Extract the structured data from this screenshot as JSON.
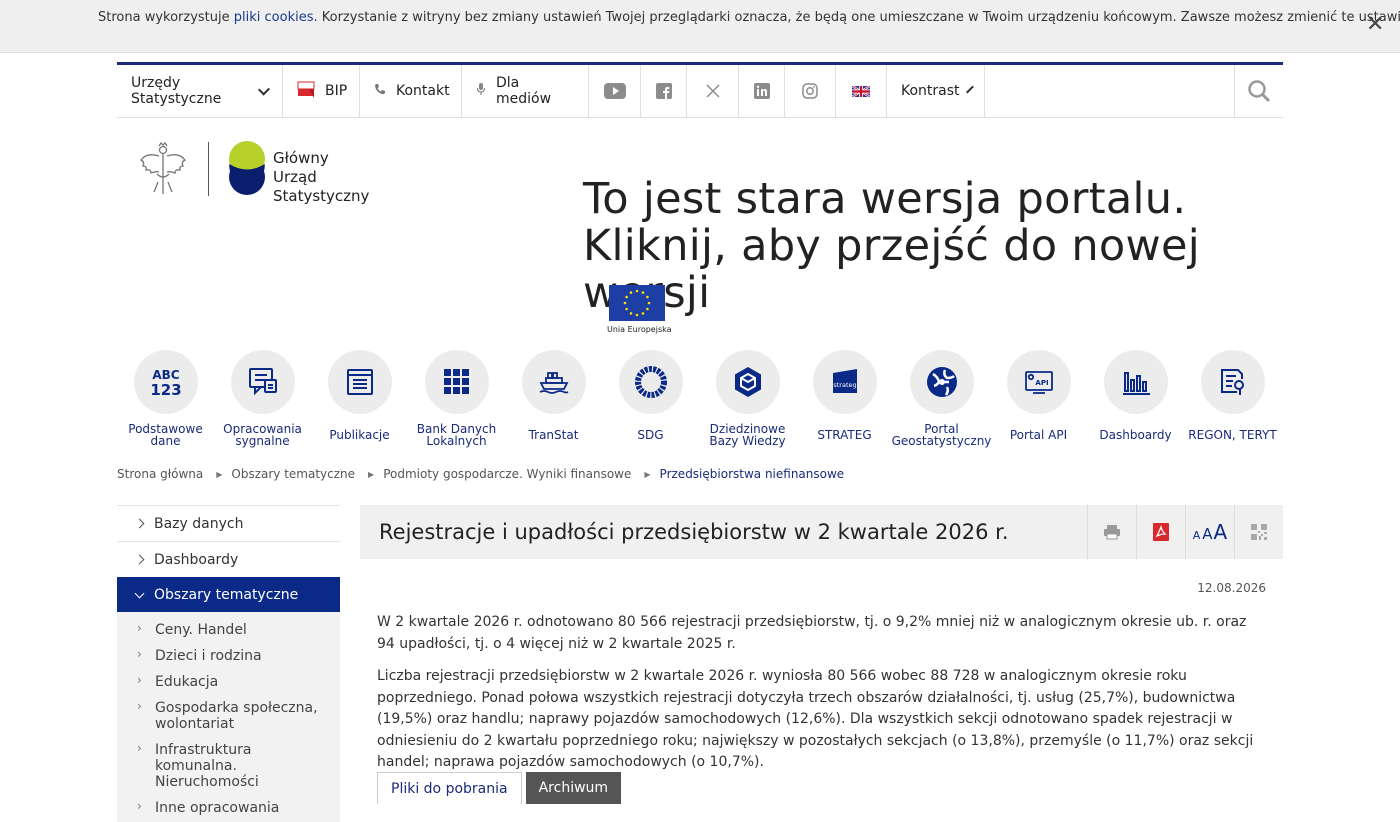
{
  "cookie": {
    "text_before": "Strona wykorzystuje ",
    "link": "pliki cookies",
    "text_after": ". Korzystanie z witryny bez zmiany ustawień Twojej przeglądarki oznacza, że będą one umieszczane w Twoim urządzeniu końcowym. Zawsze możesz zmienić te ustawienia.",
    "close": "✕"
  },
  "topnav": {
    "offices": "Urzędy Statystyczne",
    "bip": "BIP",
    "contact": "Kontakt",
    "media": "Dla mediów",
    "contrast": "Kontrast"
  },
  "logo": {
    "line1": "Główny",
    "line2": "Urząd Statystyczny"
  },
  "headline": "To jest stara wersja portalu. Kliknij, aby przejść do nowej wersji",
  "eu_label": "Unia Europejska",
  "icons": [
    {
      "label": "Podstawowe dane"
    },
    {
      "label": "Opracowania sygnalne"
    },
    {
      "label": "Publikacje"
    },
    {
      "label": "Bank Danych Lokalnych"
    },
    {
      "label": "TranStat"
    },
    {
      "label": "SDG"
    },
    {
      "label": "Dziedzinowe Bazy Wiedzy"
    },
    {
      "label": "STRATEG"
    },
    {
      "label": "Portal Geostatystyczny"
    },
    {
      "label": "Portal API"
    },
    {
      "label": "Dashboardy"
    },
    {
      "label": "REGON, TERYT"
    }
  ],
  "icon_text": {
    "abc": "ABC",
    "num": "123",
    "strateg": "strateg",
    "api": "API"
  },
  "breadcrumb": [
    "Strona główna",
    "Obszary tematyczne",
    "Podmioty gospodarcze. Wyniki finansowe",
    "Przedsiębiorstwa niefinansowe"
  ],
  "sidebar": {
    "top": [
      "Bazy danych",
      "Dashboardy"
    ],
    "active": "Obszary tematyczne",
    "sub": [
      "Ceny. Handel",
      "Dzieci i rodzina",
      "Edukacja",
      "Gospodarka społeczna, wolontariat",
      "Infrastruktura komunalna. Nieruchomości",
      "Inne opracowania"
    ]
  },
  "article": {
    "title": "Rejestracje i upadłości przedsiębiorstw w 2 kwartale 2026 r.",
    "date": "12.08.2026",
    "p1": "W 2 kwartale 2026 r. odnotowano 80 566 rejestracji przedsiębiorstw, tj. o 9,2% mniej niż w analogicznym okresie ub. r. oraz 94 upadłości, tj. o 4 więcej niż w 2 kwartale 2025 r.",
    "p2": "Liczba rejestracji przedsiębiorstw w 2 kwartale 2026 r. wyniosła 80 566 wobec 88 728 w analogicznym okresie roku poprzedniego. Ponad połowa wszystkich rejestracji dotyczyła trzech obszarów działalności, tj. usług (25,7%), budownictwa (19,5%) oraz handlu; naprawy pojazdów samochodowych (12,6%). Dla wszystkich sekcji odnotowano spadek rejestracji w odniesieniu do 2 kwartału poprzedniego roku; największy w pozostałych sekcjach (o 13,8%), przemyśle (o 11,7%) oraz sekcji handel; naprawa pojazdów samochodowych (o 10,7%).",
    "tabs": [
      "Pliki do pobrania",
      "Archiwum"
    ],
    "font_sizes": [
      "A",
      "A",
      "A"
    ]
  },
  "colors": {
    "primary": "#0b2a88",
    "accent_red": "#d9272e",
    "bg_light": "#f0f0f0"
  }
}
